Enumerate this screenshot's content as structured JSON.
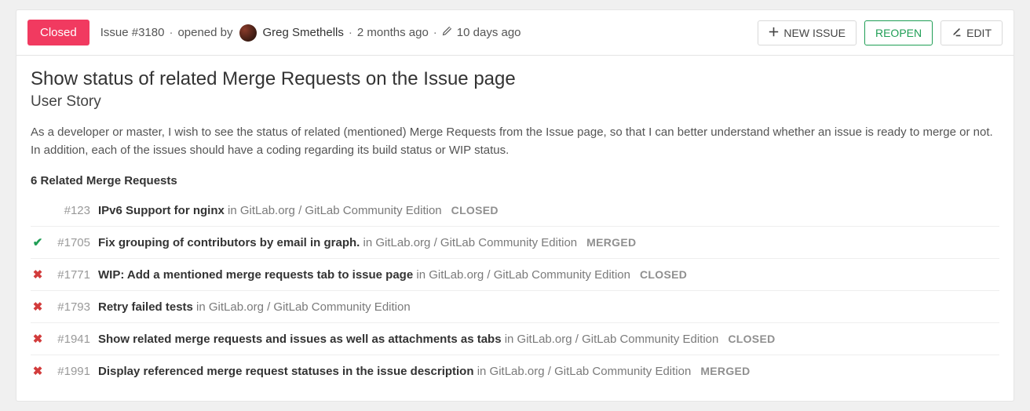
{
  "header": {
    "status": "Closed",
    "issue_ref": "Issue #3180",
    "opened_by_label": "opened by",
    "author": "Greg Smethells",
    "created_ago": "2 months ago",
    "updated_ago": "10 days ago"
  },
  "actions": {
    "new_issue": "NEW ISSUE",
    "reopen": "REOPEN",
    "edit": "EDIT"
  },
  "issue": {
    "title": "Show status of related Merge Requests on the Issue page",
    "subtitle": "User Story",
    "description": "As a developer or master, I wish to see the status of related (mentioned) Merge Requests from the Issue page, so that I can better understand whether an issue is ready to merge or not. In addition, each of the issues should have a coding regarding its build status or WIP status."
  },
  "related": {
    "heading": "6 Related Merge Requests",
    "project_prefix": "in ",
    "items": [
      {
        "icon": "",
        "num": "#123",
        "title": "IPv6 Support for nginx",
        "project": "GitLab.org / GitLab Community Edition",
        "status": "CLOSED"
      },
      {
        "icon": "check",
        "num": "#1705",
        "title": "Fix grouping of contributors by email in graph.",
        "project": "GitLab.org / GitLab Community Edition",
        "status": "MERGED"
      },
      {
        "icon": "x",
        "num": "#1771",
        "title": "WIP: Add a mentioned merge requests tab to issue page",
        "project": "GitLab.org / GitLab Community Edition",
        "status": "CLOSED"
      },
      {
        "icon": "x",
        "num": "#1793",
        "title": "Retry failed tests",
        "project": "GitLab.org / GitLab Community Edition",
        "status": ""
      },
      {
        "icon": "x",
        "num": "#1941",
        "title": "Show related merge requests and issues as well as attachments as tabs",
        "project": "GitLab.org / GitLab Community Edition",
        "status": "CLOSED"
      },
      {
        "icon": "x",
        "num": "#1991",
        "title": "Display referenced merge request statuses in the issue description",
        "project": "GitLab.org / GitLab Community Edition",
        "status": "MERGED"
      }
    ]
  }
}
